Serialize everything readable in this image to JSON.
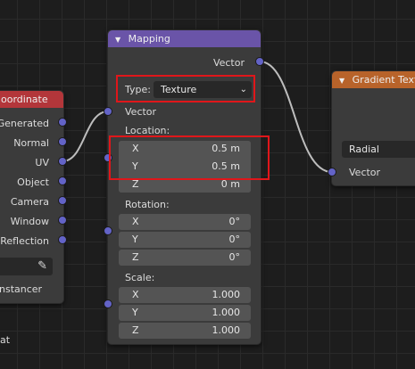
{
  "left_node": {
    "title": "oordinate",
    "outputs": [
      "Generated",
      "Normal",
      "UV",
      "Object",
      "Camera",
      "Window",
      "Reflection"
    ],
    "instancer_label": "nstancer",
    "bottom_label": "at",
    "header_color": "#b3363a"
  },
  "mapping": {
    "title": "Mapping",
    "header_color": "#6a54a8",
    "output_vector": "Vector",
    "type_label": "Type:",
    "type_value": "Texture",
    "input_vector": "Vector",
    "location": {
      "label": "Location:",
      "x_label": "X",
      "x_value": "0.5 m",
      "y_label": "Y",
      "y_value": "0.5 m",
      "z_label": "Z",
      "z_value": "0 m"
    },
    "rotation": {
      "label": "Rotation:",
      "x_label": "X",
      "x_value": "0°",
      "y_label": "Y",
      "y_value": "0°",
      "z_label": "Z",
      "z_value": "0°"
    },
    "scale": {
      "label": "Scale:",
      "x_label": "X",
      "x_value": "1.000",
      "y_label": "Y",
      "y_value": "1.000",
      "z_label": "Z",
      "z_value": "1.000"
    }
  },
  "gradient": {
    "title": "Gradient Textu",
    "header_color": "#b8632a",
    "type_value": "Radial",
    "input_vector": "Vector"
  },
  "colors": {
    "socket_vector": "#6363c7",
    "highlight": "#e0161a",
    "link": "#bdbdbd"
  }
}
